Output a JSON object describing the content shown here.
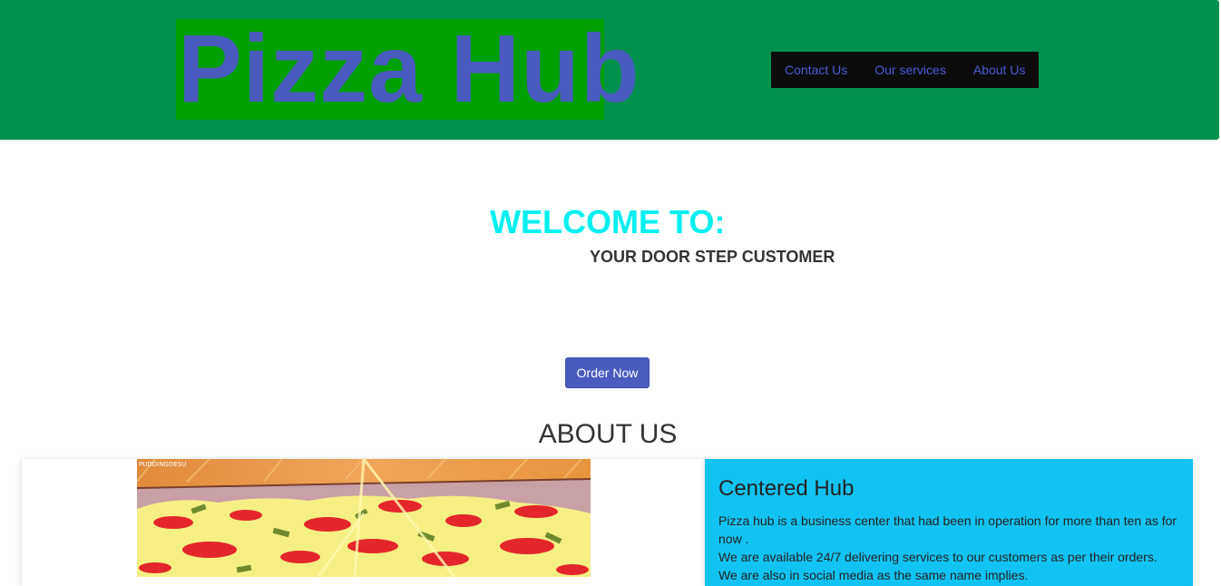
{
  "header": {
    "logo": "Pizza Hub",
    "nav": [
      {
        "label": "Contact Us"
      },
      {
        "label": "Our services"
      },
      {
        "label": "About Us"
      }
    ]
  },
  "hero": {
    "welcome": "WELCOME TO:",
    "tagline": "YOUR DOOR STEP CUSTOMER",
    "order_button": "Order Now"
  },
  "about": {
    "title": "ABOUT US",
    "image_watermark": "PUDDINGDESU",
    "card": {
      "title": "Centered Hub",
      "lines": [
        "Pizza hub is a business center that had been in operation for more than ten as for now .",
        "We are available 24/7 delivering services to our customers as per their orders.",
        "We are also in social media as the same name implies."
      ]
    }
  },
  "colors": {
    "header_bg": "#00914f",
    "logo_bg": "#00a000",
    "logo_text": "#4a5bbf",
    "nav_bg": "#0c0c0c",
    "welcome": "#00f0f0",
    "button": "#4a5bbd",
    "card_bg": "#12c3f2"
  }
}
